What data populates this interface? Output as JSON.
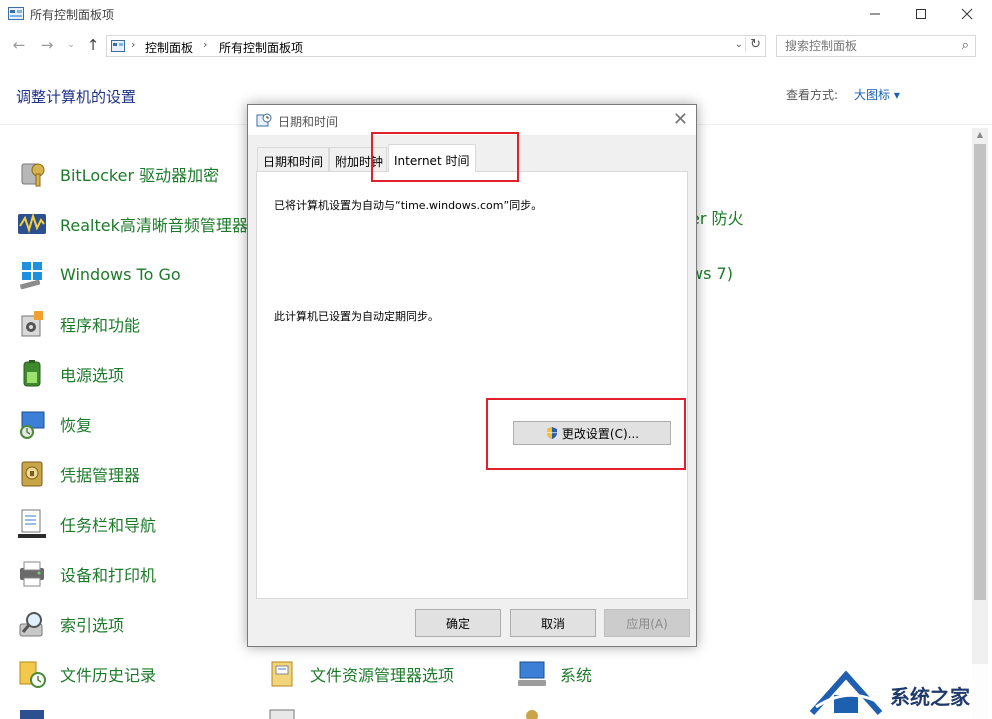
{
  "window": {
    "title": "所有控制面板项"
  },
  "address": {
    "crumbs": [
      "控制面板",
      "所有控制面板项"
    ],
    "search_placeholder": "搜索控制面板"
  },
  "header": {
    "heading": "调整计算机的设置",
    "view_label": "查看方式:",
    "view_value": "大图标 ▾"
  },
  "items": [
    {
      "label": "BitLocker 驱动器加密",
      "icon": "bitlocker-icon"
    },
    {
      "label": "Realtek高清晰音频管理器",
      "icon": "realtek-audio-icon"
    },
    {
      "label": "Windows To Go",
      "icon": "windows-to-go-icon"
    },
    {
      "label": "程序和功能",
      "icon": "programs-features-icon"
    },
    {
      "label": "电源选项",
      "icon": "power-options-icon"
    },
    {
      "label": "恢复",
      "icon": "recovery-icon"
    },
    {
      "label": "凭据管理器",
      "icon": "credential-manager-icon"
    },
    {
      "label": "任务栏和导航",
      "icon": "taskbar-navigation-icon"
    },
    {
      "label": "设备和打印机",
      "icon": "devices-printers-icon"
    },
    {
      "label": "索引选项",
      "icon": "indexing-options-icon"
    },
    {
      "label": "文件历史记录",
      "icon": "file-history-icon"
    },
    {
      "label": "文件资源管理器选项",
      "icon": "file-explorer-options-icon"
    },
    {
      "label": "系统",
      "icon": "system-icon"
    }
  ],
  "partial_items": [
    "er 防火",
    "ws 7)"
  ],
  "dialog": {
    "title": "日期和时间",
    "tabs": [
      "日期和时间",
      "附加时钟",
      "Internet 时间"
    ],
    "sync_text": "已将计算机设置为自动与“time.windows.com”同步。",
    "auto_text": "此计算机已设置为自动定期同步。",
    "change_button": "更改设置(C)...",
    "ok": "确定",
    "cancel": "取消",
    "apply": "应用(A)"
  },
  "watermark": "系统之家"
}
